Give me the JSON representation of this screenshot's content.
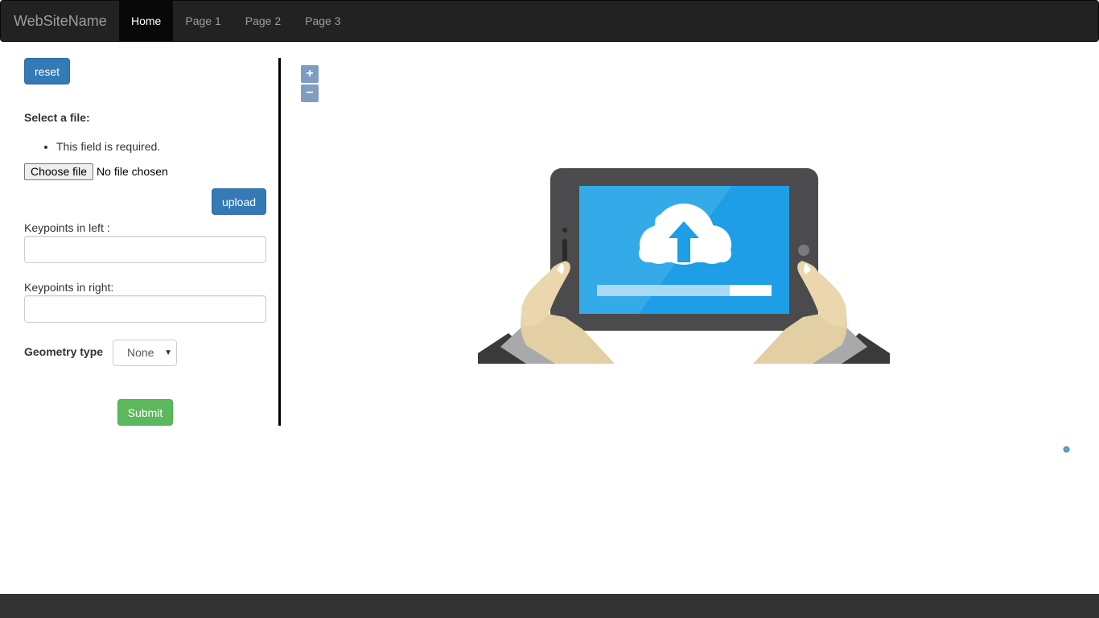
{
  "navbar": {
    "brand": "WebSiteName",
    "items": [
      {
        "label": "Home",
        "active": true
      },
      {
        "label": "Page 1",
        "active": false
      },
      {
        "label": "Page 2",
        "active": false
      },
      {
        "label": "Page 3",
        "active": false
      }
    ]
  },
  "form": {
    "reset_label": "reset",
    "select_file_label": "Select a file:",
    "error_message": "This field is required.",
    "choose_file_label": "Choose file",
    "no_file_text": "No file chosen",
    "upload_label": "upload",
    "keypoints_left_label": "Keypoints in left :",
    "keypoints_left_value": "",
    "keypoints_right_label": "Keypoints in right:",
    "keypoints_right_value": "",
    "geometry_type_label": "Geometry type",
    "geometry_type_value": "None",
    "submit_label": "Submit"
  },
  "map": {
    "zoom_in_label": "+",
    "zoom_out_label": "−"
  },
  "colors": {
    "navbar_bg": "#222222",
    "primary": "#337ab7",
    "success": "#5cb85c",
    "screen_blue": "#1e9ee6",
    "footer_bg": "#333333"
  },
  "icons": [
    "upload-cloud-illustration",
    "map-marker-dot-icon",
    "zoom-in-icon",
    "zoom-out-icon"
  ]
}
